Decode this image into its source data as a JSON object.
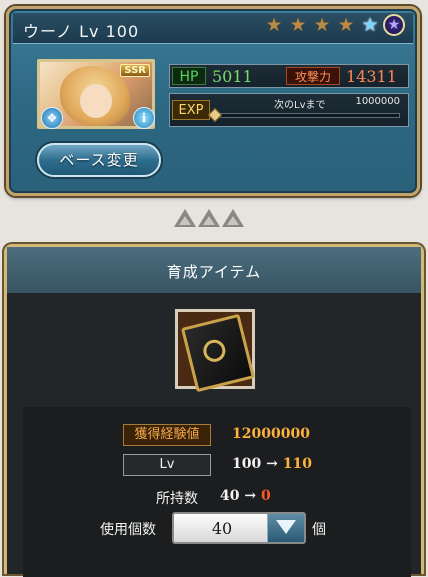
{
  "character": {
    "name": "ウーノ",
    "level_text": "Lv 100",
    "rarity": "SSR",
    "stars_filled": 4,
    "hp_label": "HP",
    "hp_value": "5011",
    "atk_label": "攻撃力",
    "atk_value": "14311",
    "exp_label": "EXP",
    "exp_next_label": "次のLvまで",
    "exp_next_value": "1000000",
    "exp_progress": 0.0,
    "base_change_label": "ベース変更"
  },
  "items_panel": {
    "title": "育成アイテム",
    "gained_exp_label": "獲得経験値",
    "gained_exp_value": "12000000",
    "lv_label": "Lv",
    "lv_from": "100",
    "lv_arrow": "→",
    "lv_to": "110",
    "owned_label": "所持数",
    "owned_from": "40",
    "owned_arrow": "→",
    "owned_to": "0",
    "use_count_label": "使用個数",
    "use_count_value": "40",
    "use_count_unit": "個"
  },
  "colors": {
    "accent_gold": "#c2a46a",
    "panel_blue": "#3b7c97",
    "hp_green": "#7ddb68",
    "atk_orange": "#ff8552",
    "exp_value": "#ffb23c",
    "decrease_red": "#ff5a2a"
  }
}
